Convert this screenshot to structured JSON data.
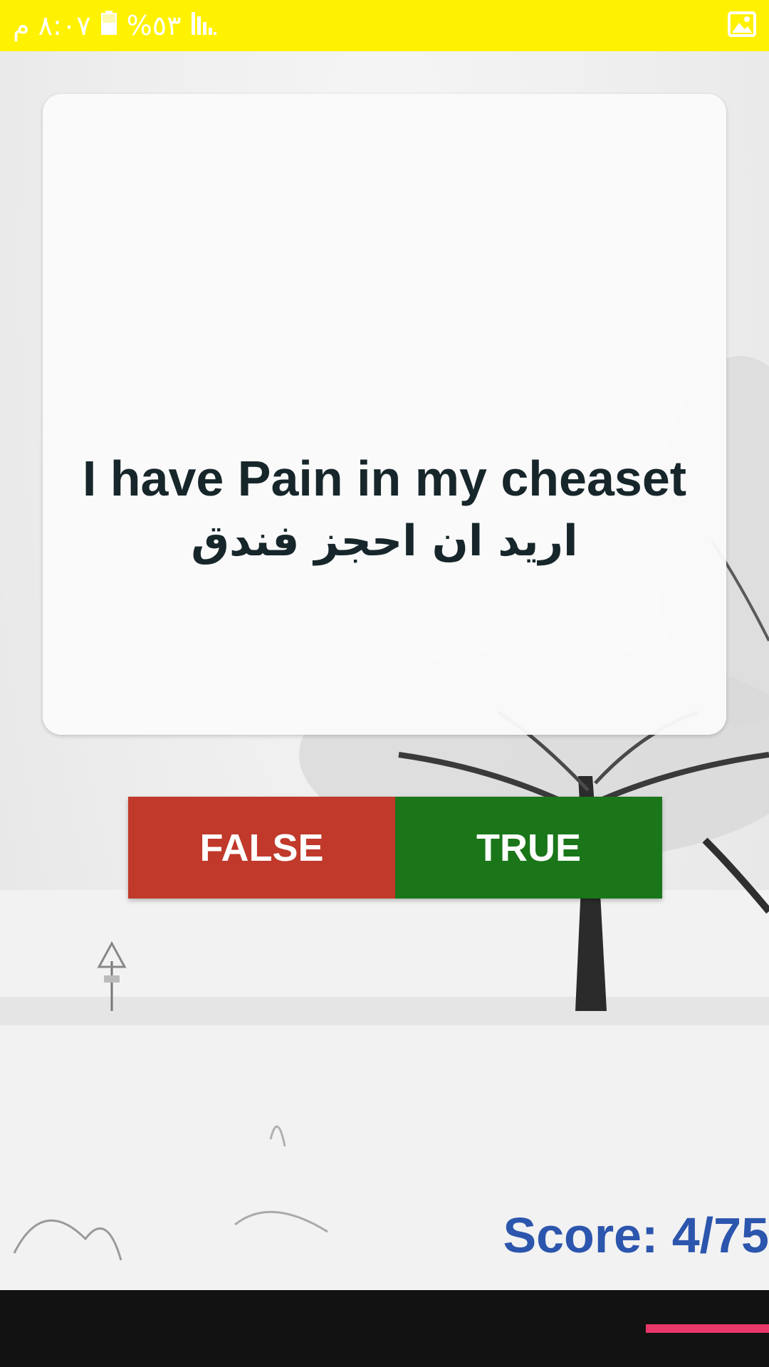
{
  "status_bar": {
    "time": "٨:٠٧ م",
    "battery_percent": "%٥٣",
    "background_color": "#fff200",
    "icons": [
      "signal-icon",
      "battery-icon",
      "image-notification-icon"
    ]
  },
  "card": {
    "question_english": "I have Pain in my cheaset",
    "question_arabic": "اريد ان احجز فندق"
  },
  "answers": {
    "false_label": "FALSE",
    "true_label": "TRUE",
    "false_color": "#c0392b",
    "true_color": "#1a7619"
  },
  "score": {
    "text": "Score: 4/75",
    "color": "#2c56ad"
  },
  "bottom_bar": {
    "indicator_color": "#e8386a"
  }
}
